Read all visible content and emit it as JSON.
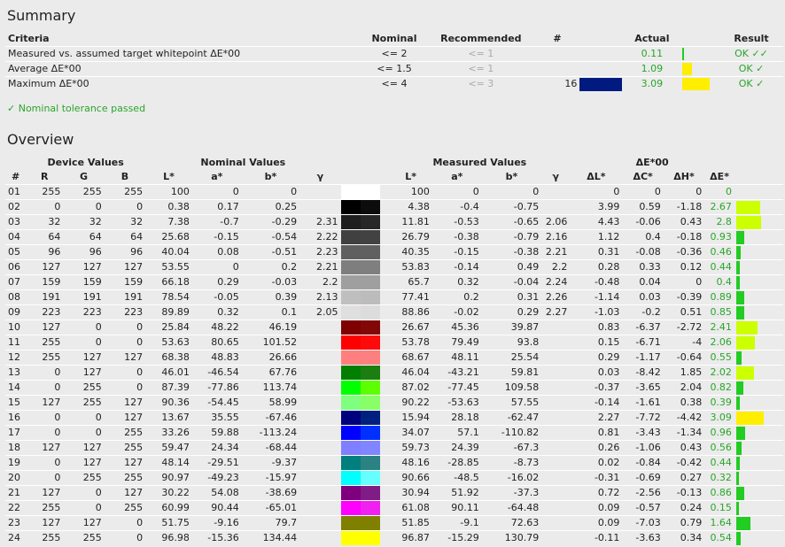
{
  "summary": {
    "title": "Summary",
    "headers": {
      "criteria": "Criteria",
      "nominal": "Nominal",
      "recommended": "Recommended",
      "hash": "#",
      "actual": "Actual",
      "result": "Result"
    },
    "rows": [
      {
        "criteria": "Measured vs. assumed target whitepoint ΔE*00",
        "nominal": "<= 2",
        "recommended": "<= 1",
        "num": "",
        "swatch": "",
        "actual": "0.11",
        "fill": 0.0275,
        "fill_color": "#22cc22",
        "result": "OK ✓✓"
      },
      {
        "criteria": "Average ΔE*00",
        "nominal": "<= 1.5",
        "recommended": "<= 1",
        "num": "",
        "swatch": "",
        "actual": "1.09",
        "fill": 0.2725,
        "fill_color": "#ffee00",
        "result": "OK ✓"
      },
      {
        "criteria": "Maximum ΔE*00",
        "nominal": "<= 4",
        "recommended": "<= 3",
        "num": "16",
        "swatch": "#001a80",
        "actual": "3.09",
        "fill": 0.7725,
        "fill_color": "#ffee00",
        "result": "OK ✓"
      }
    ],
    "status": "✓ Nominal tolerance passed"
  },
  "overview": {
    "title": "Overview",
    "group_headers": {
      "device": "Device Values",
      "nominal": "Nominal Values",
      "measured": "Measured Values",
      "de": "ΔE*00"
    },
    "col_headers": [
      "#",
      "R",
      "G",
      "B",
      "L*",
      "a*",
      "b*",
      "γ",
      "",
      "L*",
      "a*",
      "b*",
      "γ",
      "ΔL*",
      "ΔC*",
      "ΔH*",
      "ΔE*",
      ""
    ],
    "rows": [
      {
        "n": "01",
        "r": "255",
        "g": "255",
        "b": "255",
        "L": "100",
        "a": "0",
        "bb": "0",
        "gam": "",
        "c1": "#ffffff",
        "c2": "#ffffff",
        "mL": "100",
        "ma": "0",
        "mb": "0",
        "mg": "",
        "dL": "0",
        "dC": "0",
        "dH": "0",
        "dE": "0",
        "de_val": 0
      },
      {
        "n": "02",
        "r": "0",
        "g": "0",
        "b": "0",
        "L": "0.38",
        "a": "0.17",
        "bb": "0.25",
        "gam": "",
        "c1": "#000000",
        "c2": "#0c0c0c",
        "mL": "4.38",
        "ma": "-0.4",
        "mb": "-0.75",
        "mg": "",
        "dL": "3.99",
        "dC": "0.59",
        "dH": "-1.18",
        "dE": "2.67",
        "de_val": 2.67
      },
      {
        "n": "03",
        "r": "32",
        "g": "32",
        "b": "32",
        "L": "7.38",
        "a": "-0.7",
        "bb": "-0.29",
        "gam": "2.31",
        "c1": "#1e1e1e",
        "c2": "#272727",
        "mL": "11.81",
        "ma": "-0.53",
        "mb": "-0.65",
        "mg": "2.06",
        "dL": "4.43",
        "dC": "-0.06",
        "dH": "0.43",
        "dE": "2.8",
        "de_val": 2.8
      },
      {
        "n": "04",
        "r": "64",
        "g": "64",
        "b": "64",
        "L": "25.68",
        "a": "-0.15",
        "bb": "-0.54",
        "gam": "2.22",
        "c1": "#404040",
        "c2": "#424242",
        "mL": "26.79",
        "ma": "-0.38",
        "mb": "-0.79",
        "mg": "2.16",
        "dL": "1.12",
        "dC": "0.4",
        "dH": "-0.18",
        "dE": "0.93",
        "de_val": 0.93
      },
      {
        "n": "05",
        "r": "96",
        "g": "96",
        "b": "96",
        "L": "40.04",
        "a": "0.08",
        "bb": "-0.51",
        "gam": "2.23",
        "c1": "#5f5f5f",
        "c2": "#606060",
        "mL": "40.35",
        "ma": "-0.15",
        "mb": "-0.38",
        "mg": "2.21",
        "dL": "0.31",
        "dC": "-0.08",
        "dH": "-0.36",
        "dE": "0.46",
        "de_val": 0.46
      },
      {
        "n": "06",
        "r": "127",
        "g": "127",
        "b": "127",
        "L": "53.55",
        "a": "0",
        "bb": "0.2",
        "gam": "2.21",
        "c1": "#7e7e7e",
        "c2": "#7f7f7f",
        "mL": "53.83",
        "ma": "-0.14",
        "mb": "0.49",
        "mg": "2.2",
        "dL": "0.28",
        "dC": "0.33",
        "dH": "0.12",
        "dE": "0.44",
        "de_val": 0.44
      },
      {
        "n": "07",
        "r": "159",
        "g": "159",
        "b": "159",
        "L": "66.18",
        "a": "0.29",
        "bb": "-0.03",
        "gam": "2.2",
        "c1": "#9f9f9f",
        "c2": "#9f9f9f",
        "mL": "65.7",
        "ma": "0.32",
        "mb": "-0.04",
        "mg": "2.24",
        "dL": "-0.48",
        "dC": "0.04",
        "dH": "0",
        "dE": "0.4",
        "de_val": 0.4
      },
      {
        "n": "08",
        "r": "191",
        "g": "191",
        "b": "191",
        "L": "78.54",
        "a": "-0.05",
        "bb": "0.39",
        "gam": "2.13",
        "c1": "#bfbfbf",
        "c2": "#bcbcbc",
        "mL": "77.41",
        "ma": "0.2",
        "mb": "0.31",
        "mg": "2.26",
        "dL": "-1.14",
        "dC": "0.03",
        "dH": "-0.39",
        "dE": "0.89",
        "de_val": 0.89
      },
      {
        "n": "09",
        "r": "223",
        "g": "223",
        "b": "223",
        "L": "89.89",
        "a": "0.32",
        "bb": "0.1",
        "gam": "2.05",
        "c1": "#dfdfdf",
        "c2": "#dcdcdc",
        "mL": "88.86",
        "ma": "-0.02",
        "mb": "0.29",
        "mg": "2.27",
        "dL": "-1.03",
        "dC": "-0.2",
        "dH": "0.51",
        "dE": "0.85",
        "de_val": 0.85
      },
      {
        "n": "10",
        "r": "127",
        "g": "0",
        "b": "0",
        "L": "25.84",
        "a": "48.22",
        "bb": "46.19",
        "gam": "",
        "c1": "#7f0000",
        "c2": "#820808",
        "mL": "26.67",
        "ma": "45.36",
        "mb": "39.87",
        "mg": "",
        "dL": "0.83",
        "dC": "-6.37",
        "dH": "-2.72",
        "dE": "2.41",
        "de_val": 2.41
      },
      {
        "n": "11",
        "r": "255",
        "g": "0",
        "b": "0",
        "L": "53.63",
        "a": "80.65",
        "bb": "101.52",
        "gam": "",
        "c1": "#ff0000",
        "c2": "#ff0a0a",
        "mL": "53.78",
        "ma": "79.49",
        "mb": "93.8",
        "mg": "",
        "dL": "0.15",
        "dC": "-6.71",
        "dH": "-4",
        "dE": "2.06",
        "de_val": 2.06
      },
      {
        "n": "12",
        "r": "255",
        "g": "127",
        "b": "127",
        "L": "68.38",
        "a": "48.83",
        "bb": "26.66",
        "gam": "",
        "c1": "#ff7f7f",
        "c2": "#fc8080",
        "mL": "68.67",
        "ma": "48.11",
        "mb": "25.54",
        "mg": "",
        "dL": "0.29",
        "dC": "-1.17",
        "dH": "-0.64",
        "dE": "0.55",
        "de_val": 0.55
      },
      {
        "n": "13",
        "r": "0",
        "g": "127",
        "b": "0",
        "L": "46.01",
        "a": "-46.54",
        "bb": "67.76",
        "gam": "",
        "c1": "#007f00",
        "c2": "#1a7f10",
        "mL": "46.04",
        "ma": "-43.21",
        "mb": "59.81",
        "mg": "",
        "dL": "0.03",
        "dC": "-8.42",
        "dH": "1.85",
        "dE": "2.02",
        "de_val": 2.02
      },
      {
        "n": "14",
        "r": "0",
        "g": "255",
        "b": "0",
        "L": "87.39",
        "a": "-77.86",
        "bb": "113.74",
        "gam": "",
        "c1": "#00ff00",
        "c2": "#5cff00",
        "mL": "87.02",
        "ma": "-77.45",
        "mb": "109.58",
        "mg": "",
        "dL": "-0.37",
        "dC": "-3.65",
        "dH": "2.04",
        "dE": "0.82",
        "de_val": 0.82
      },
      {
        "n": "15",
        "r": "127",
        "g": "255",
        "b": "127",
        "L": "90.36",
        "a": "-54.45",
        "bb": "58.99",
        "gam": "",
        "c1": "#7fff7f",
        "c2": "#88ff66",
        "mL": "90.22",
        "ma": "-53.63",
        "mb": "57.55",
        "mg": "",
        "dL": "-0.14",
        "dC": "-1.61",
        "dH": "0.38",
        "dE": "0.39",
        "de_val": 0.39
      },
      {
        "n": "16",
        "r": "0",
        "g": "0",
        "b": "127",
        "L": "13.67",
        "a": "35.55",
        "bb": "-67.46",
        "gam": "",
        "c1": "#00007f",
        "c2": "#002080",
        "mL": "15.94",
        "ma": "28.18",
        "mb": "-62.47",
        "mg": "",
        "dL": "2.27",
        "dC": "-7.72",
        "dH": "-4.42",
        "dE": "3.09",
        "de_val": 3.09
      },
      {
        "n": "17",
        "r": "0",
        "g": "0",
        "b": "255",
        "L": "33.26",
        "a": "59.88",
        "bb": "-113.24",
        "gam": "",
        "c1": "#0000ff",
        "c2": "#0030ff",
        "mL": "34.07",
        "ma": "57.1",
        "mb": "-110.82",
        "mg": "",
        "dL": "0.81",
        "dC": "-3.43",
        "dH": "-1.34",
        "dE": "0.96",
        "de_val": 0.96
      },
      {
        "n": "18",
        "r": "127",
        "g": "127",
        "b": "255",
        "L": "59.47",
        "a": "24.34",
        "bb": "-68.44",
        "gam": "",
        "c1": "#7f7fff",
        "c2": "#7f86ff",
        "mL": "59.73",
        "ma": "24.39",
        "mb": "-67.3",
        "mg": "",
        "dL": "0.26",
        "dC": "-1.06",
        "dH": "0.43",
        "dE": "0.56",
        "de_val": 0.56
      },
      {
        "n": "19",
        "r": "0",
        "g": "127",
        "b": "127",
        "L": "48.14",
        "a": "-29.51",
        "bb": "-9.37",
        "gam": "",
        "c1": "#007f7f",
        "c2": "#2a8282",
        "mL": "48.16",
        "ma": "-28.85",
        "mb": "-8.73",
        "mg": "",
        "dL": "0.02",
        "dC": "-0.84",
        "dH": "-0.42",
        "dE": "0.44",
        "de_val": 0.44
      },
      {
        "n": "20",
        "r": "0",
        "g": "255",
        "b": "255",
        "L": "90.97",
        "a": "-49.23",
        "bb": "-15.97",
        "gam": "",
        "c1": "#00ffff",
        "c2": "#66ffff",
        "mL": "90.66",
        "ma": "-48.5",
        "mb": "-16.02",
        "mg": "",
        "dL": "-0.31",
        "dC": "-0.69",
        "dH": "0.27",
        "dE": "0.32",
        "de_val": 0.32
      },
      {
        "n": "21",
        "r": "127",
        "g": "0",
        "b": "127",
        "L": "30.22",
        "a": "54.08",
        "bb": "-38.69",
        "gam": "",
        "c1": "#7f007f",
        "c2": "#801c86",
        "mL": "30.94",
        "ma": "51.92",
        "mb": "-37.3",
        "mg": "",
        "dL": "0.72",
        "dC": "-2.56",
        "dH": "-0.13",
        "dE": "0.86",
        "de_val": 0.86
      },
      {
        "n": "22",
        "r": "255",
        "g": "0",
        "b": "255",
        "L": "60.99",
        "a": "90.44",
        "bb": "-65.01",
        "gam": "",
        "c1": "#ff00ff",
        "c2": "#f020f0",
        "mL": "61.08",
        "ma": "90.11",
        "mb": "-64.48",
        "mg": "",
        "dL": "0.09",
        "dC": "-0.57",
        "dH": "0.24",
        "dE": "0.15",
        "de_val": 0.15
      },
      {
        "n": "23",
        "r": "127",
        "g": "127",
        "b": "0",
        "L": "51.75",
        "a": "-9.16",
        "bb": "79.7",
        "gam": "",
        "c1": "#7f7f00",
        "c2": "#808000",
        "mL": "51.85",
        "ma": "-9.1",
        "mb": "72.63",
        "mg": "",
        "dL": "0.09",
        "dC": "-7.03",
        "dH": "0.79",
        "dE": "1.64",
        "de_val": 1.64
      },
      {
        "n": "24",
        "r": "255",
        "g": "255",
        "b": "0",
        "L": "96.98",
        "a": "-15.36",
        "bb": "134.44",
        "gam": "",
        "c1": "#ffff00",
        "c2": "#ffff00",
        "mL": "96.87",
        "ma": "-15.29",
        "mb": "130.79",
        "mg": "",
        "dL": "-0.11",
        "dC": "-3.63",
        "dH": "0.34",
        "dE": "0.54",
        "de_val": 0.54
      }
    ]
  }
}
